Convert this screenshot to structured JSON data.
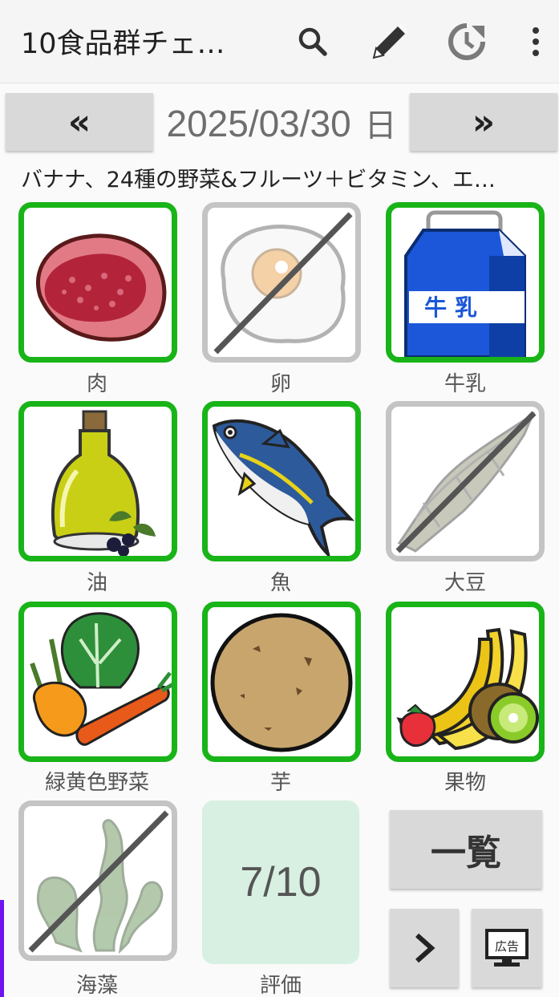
{
  "appbar": {
    "title": "10食品群チェ…",
    "icons": [
      "search-icon",
      "edit-icon",
      "history-icon",
      "more-vert-icon"
    ]
  },
  "datebar": {
    "prev_label": "«",
    "next_label": "»",
    "date": "2025/03/30",
    "weekday": "日"
  },
  "memo": "バナナ、24種の野菜&フルーツ＋ビタミン、エ…",
  "groups": [
    {
      "label": "肉",
      "checked": true,
      "icon": "meat-icon"
    },
    {
      "label": "卵",
      "checked": false,
      "icon": "egg-icon"
    },
    {
      "label": "牛乳",
      "checked": true,
      "icon": "milk-icon",
      "icon_text": "牛 乳"
    },
    {
      "label": "油",
      "checked": true,
      "icon": "oil-icon"
    },
    {
      "label": "魚",
      "checked": true,
      "icon": "fish-icon"
    },
    {
      "label": "大豆",
      "checked": false,
      "icon": "soybean-icon"
    },
    {
      "label": "緑黄色野菜",
      "checked": true,
      "icon": "vegetables-icon"
    },
    {
      "label": "芋",
      "checked": true,
      "icon": "potato-icon"
    },
    {
      "label": "果物",
      "checked": true,
      "icon": "fruit-icon"
    },
    {
      "label": "海藻",
      "checked": false,
      "icon": "seaweed-icon"
    }
  ],
  "score": {
    "value": "7/10",
    "label": "評価"
  },
  "list_button": "一覧",
  "ad_icon_text": "広告",
  "colors": {
    "checked_border": "#18b418",
    "unchecked_border": "#c4c4c4",
    "score_bg": "#d8f0e2",
    "accent": "#6d14ef"
  }
}
